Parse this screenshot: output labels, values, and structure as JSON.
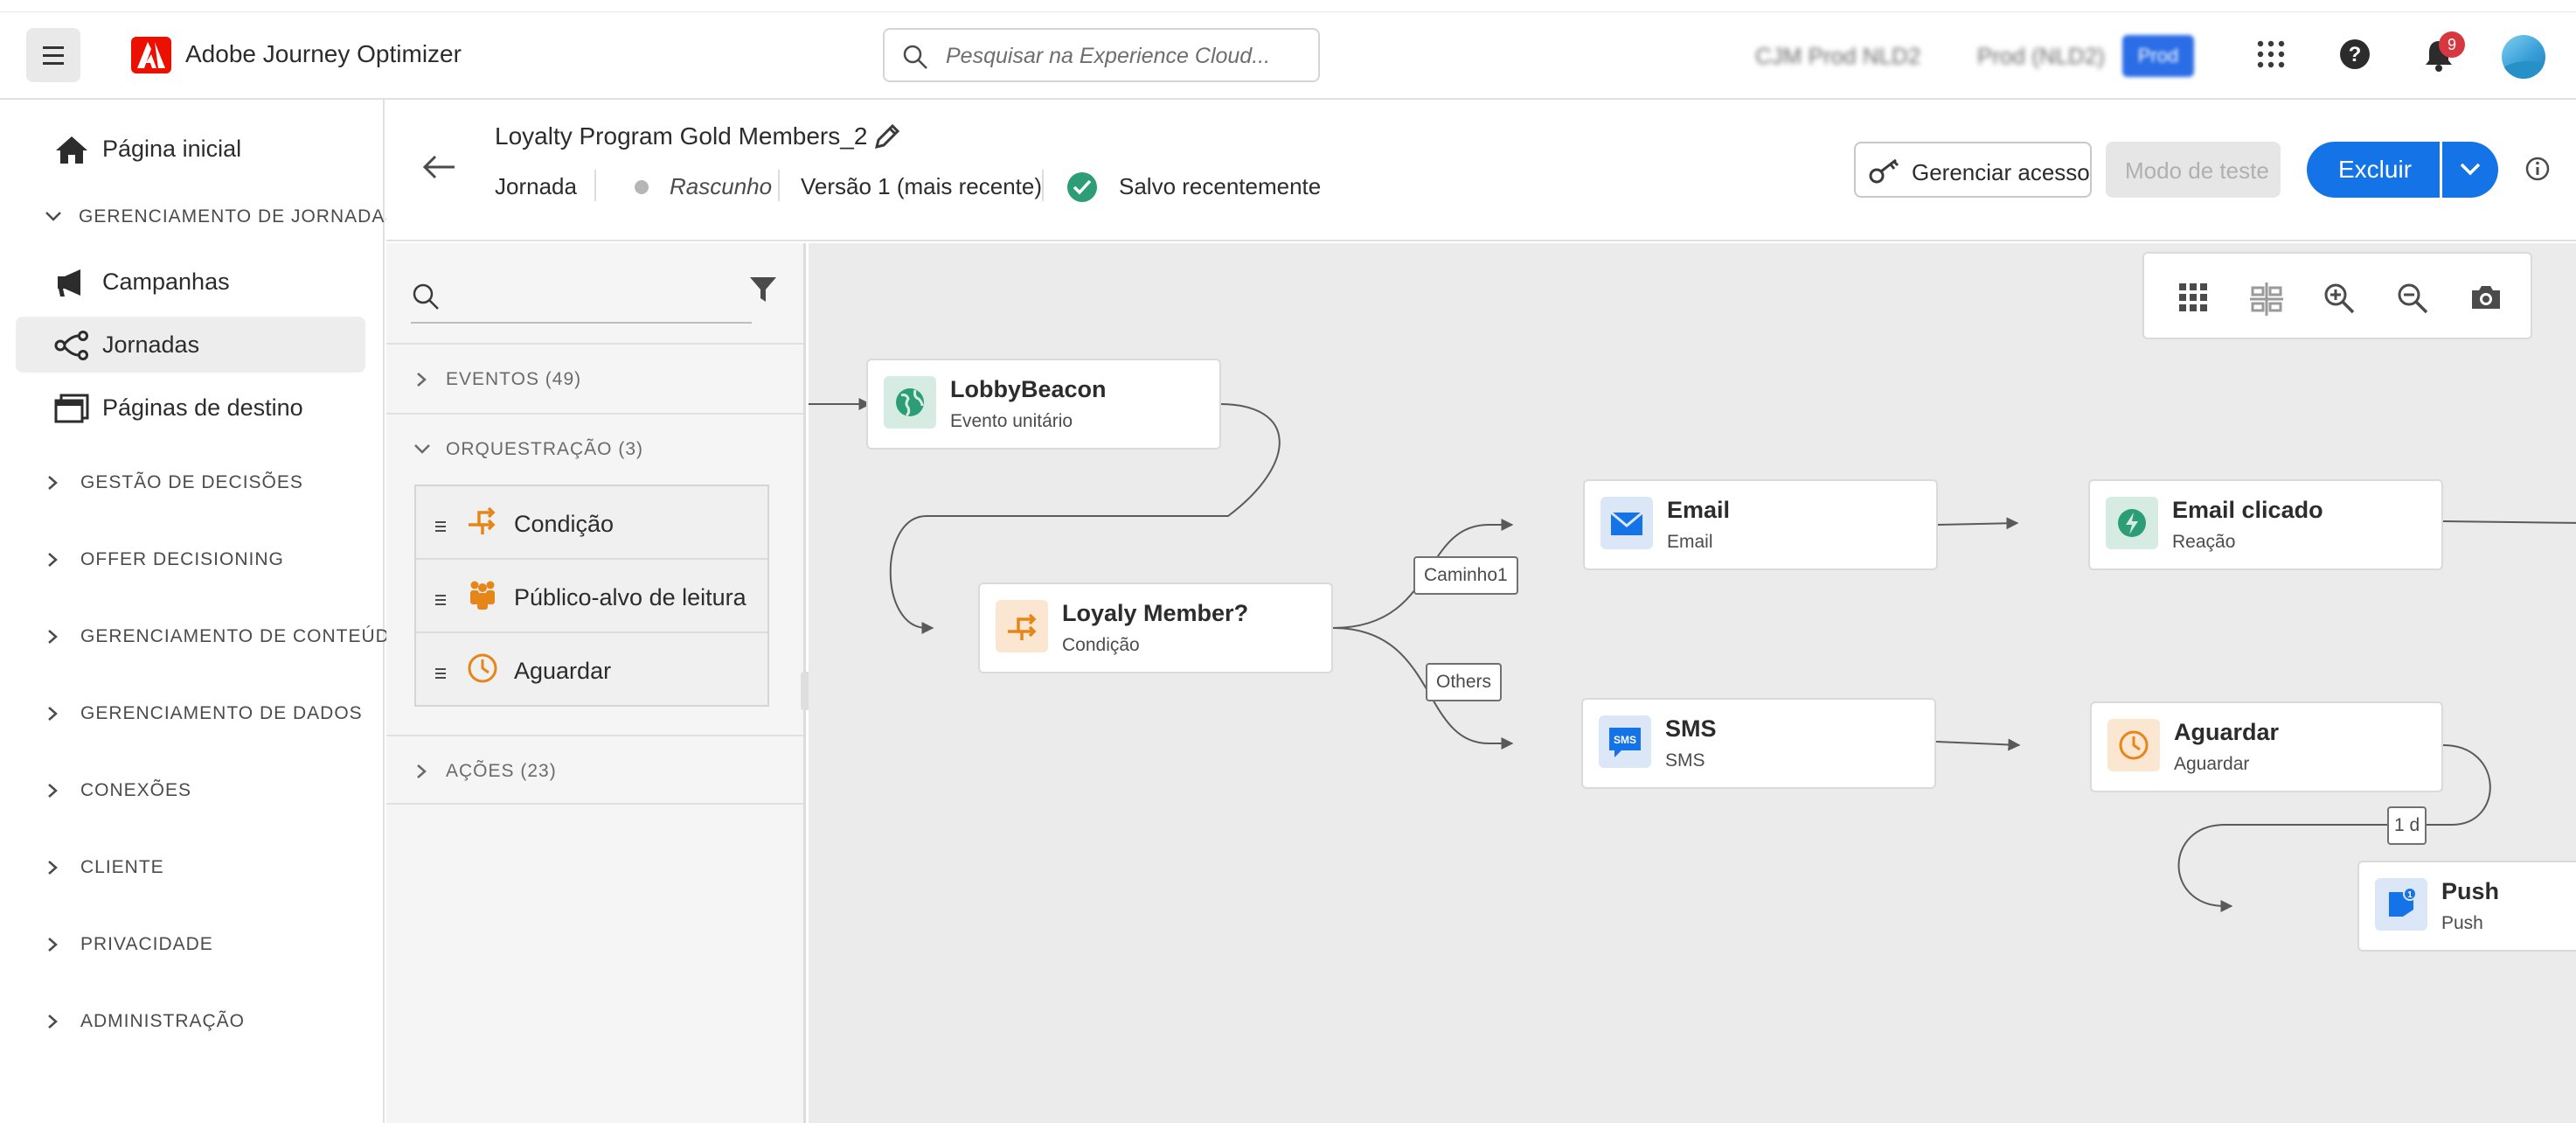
{
  "header": {
    "app_title": "Adobe Journey Optimizer",
    "search_placeholder": "Pesquisar na Experience Cloud...",
    "org_name": "CJM Prod NLD2",
    "sandbox_name": "Prod (NLD2)",
    "env_badge": "Prod",
    "notification_count": "9"
  },
  "sidebar": {
    "items": [
      {
        "label": "Página inicial",
        "icon": "home-icon"
      },
      {
        "label": "Campanhas",
        "icon": "megaphone-icon"
      },
      {
        "label": "Jornadas",
        "icon": "journey-icon",
        "active": true
      },
      {
        "label": "Páginas de destino",
        "icon": "landing-page-icon"
      }
    ],
    "section_expanded": "GERENCIAMENTO DE JORNADAS",
    "sections": [
      "GESTÃO DE DECISÕES",
      "OFFER DECISIONING",
      "GERENCIAMENTO DE CONTEÚDO",
      "GERENCIAMENTO DE DADOS",
      "CONEXÕES",
      "CLIENTE",
      "PRIVACIDADE",
      "ADMINISTRAÇÃO"
    ]
  },
  "journey": {
    "title": "Loyalty Program Gold Members_2",
    "type": "Jornada",
    "status": "Rascunho",
    "version": "Versão 1 (mais recente)",
    "save_state": "Salvo recentemente",
    "buttons": {
      "manage_access": "Gerenciar acesso",
      "test_mode": "Modo de teste",
      "delete": "Excluir"
    }
  },
  "palette": {
    "events_label": "EVENTOS (49)",
    "orchestration_label": "ORQUESTRAÇÃO (3)",
    "orchestration_items": [
      {
        "label": "Condição",
        "icon": "condition-icon"
      },
      {
        "label": "Público-alvo de leitura",
        "icon": "audience-icon"
      },
      {
        "label": "Aguardar",
        "icon": "clock-icon"
      }
    ],
    "actions_label": "AÇÕES (23)"
  },
  "canvas": {
    "nodes": [
      {
        "id": "lobby",
        "title": "LobbyBeacon",
        "subtitle": "Evento unitário"
      },
      {
        "id": "loyalty",
        "title": "Loyaly Member?",
        "subtitle": "Condição"
      },
      {
        "id": "email",
        "title": "Email",
        "subtitle": "Email"
      },
      {
        "id": "emailclick",
        "title": "Email clicado",
        "subtitle": "Reação"
      },
      {
        "id": "sms",
        "title": "SMS",
        "subtitle": "SMS"
      },
      {
        "id": "wait",
        "title": "Aguardar",
        "subtitle": "Aguardar"
      },
      {
        "id": "push",
        "title": "Push",
        "subtitle": "Push"
      }
    ],
    "edge_labels": {
      "path1": "Caminho1",
      "others": "Others",
      "wait_duration": "1 d"
    }
  },
  "colors": {
    "primary": "#1473e6",
    "adobe_red": "#eb1000",
    "event_green": "#2d9d78",
    "condition_orange": "#e68619",
    "email_blue": "#1473e6"
  }
}
